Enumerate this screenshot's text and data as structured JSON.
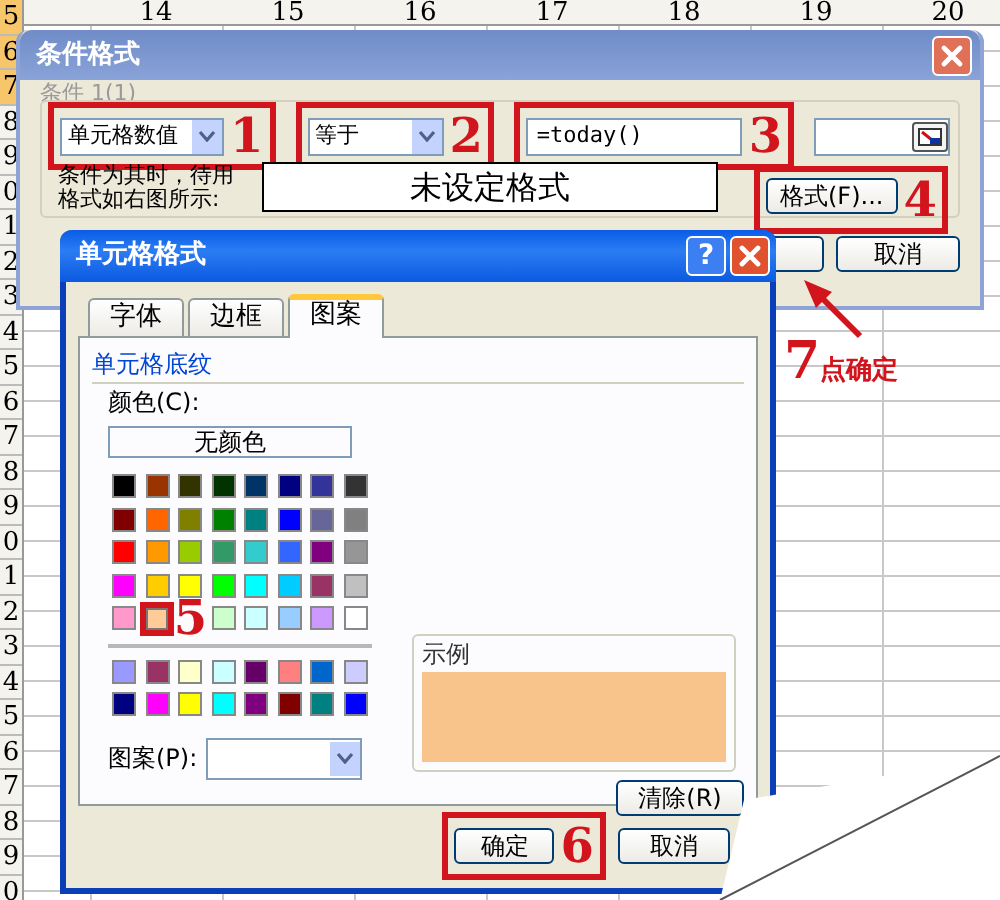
{
  "spreadsheet": {
    "column_headers": [
      "14",
      "15",
      "16",
      "17",
      "18",
      "19",
      "20"
    ],
    "row_headers": [
      {
        "label": "5",
        "selected": true
      },
      {
        "label": "6",
        "selected": true
      },
      {
        "label": "7",
        "selected": true
      },
      {
        "label": "8",
        "selected": false
      },
      {
        "label": "9",
        "selected": false
      },
      {
        "label": "0",
        "selected": false
      },
      {
        "label": "1",
        "selected": false
      },
      {
        "label": "2",
        "selected": false
      },
      {
        "label": "3",
        "selected": false
      },
      {
        "label": "4",
        "selected": false
      },
      {
        "label": "5",
        "selected": false
      },
      {
        "label": "6",
        "selected": false
      },
      {
        "label": "7",
        "selected": false
      },
      {
        "label": "8",
        "selected": false
      },
      {
        "label": "9",
        "selected": false
      },
      {
        "label": "0",
        "selected": false
      },
      {
        "label": "1",
        "selected": false
      },
      {
        "label": "2",
        "selected": false
      },
      {
        "label": "3",
        "selected": false
      },
      {
        "label": "4",
        "selected": false
      },
      {
        "label": "5",
        "selected": false
      },
      {
        "label": "6",
        "selected": false
      },
      {
        "label": "7",
        "selected": false
      },
      {
        "label": "8",
        "selected": false
      },
      {
        "label": "9",
        "selected": false
      },
      {
        "label": "0",
        "selected": false
      }
    ]
  },
  "conditional_format_dialog": {
    "title": "条件格式",
    "condition_label": "条件 1(1)",
    "condition_type": {
      "value": "单元格数值",
      "annotation": "1"
    },
    "operator": {
      "value": "等于",
      "annotation": "2"
    },
    "formula": {
      "value": "=today()",
      "annotation": "3"
    },
    "preview_caption": "条件为其时，待用格式如右图所示:",
    "preview_text": "未设定格式",
    "format_button": {
      "label": "格式(F)...",
      "annotation": "4"
    },
    "cancel_button": "取消"
  },
  "cell_format_dialog": {
    "title": "单元格格式",
    "help_button": "?",
    "tabs": [
      {
        "label": "字体",
        "selected": false
      },
      {
        "label": "边框",
        "selected": false
      },
      {
        "label": "图案",
        "selected": true
      }
    ],
    "shading_group": "单元格底纹",
    "color_label": "颜色(C):",
    "no_color_button": "无颜色",
    "standard_colors": [
      {
        "color": "#000000",
        "selected": false
      },
      {
        "color": "#993300",
        "selected": false
      },
      {
        "color": "#333300",
        "selected": false
      },
      {
        "color": "#003300",
        "selected": false
      },
      {
        "color": "#003366",
        "selected": false
      },
      {
        "color": "#000080",
        "selected": false
      },
      {
        "color": "#333399",
        "selected": false
      },
      {
        "color": "#333333",
        "selected": false
      },
      {
        "color": "#800000",
        "selected": false
      },
      {
        "color": "#ff6600",
        "selected": false
      },
      {
        "color": "#808000",
        "selected": false
      },
      {
        "color": "#008000",
        "selected": false
      },
      {
        "color": "#008080",
        "selected": false
      },
      {
        "color": "#0000ff",
        "selected": false
      },
      {
        "color": "#666699",
        "selected": false
      },
      {
        "color": "#808080",
        "selected": false
      },
      {
        "color": "#ff0000",
        "selected": false
      },
      {
        "color": "#ff9900",
        "selected": false
      },
      {
        "color": "#99cc00",
        "selected": false
      },
      {
        "color": "#339966",
        "selected": false
      },
      {
        "color": "#33cccc",
        "selected": false
      },
      {
        "color": "#3366ff",
        "selected": false
      },
      {
        "color": "#800080",
        "selected": false
      },
      {
        "color": "#969696",
        "selected": false
      },
      {
        "color": "#ff00ff",
        "selected": false
      },
      {
        "color": "#ffcc00",
        "selected": false
      },
      {
        "color": "#ffff00",
        "selected": false
      },
      {
        "color": "#00ff00",
        "selected": false
      },
      {
        "color": "#00ffff",
        "selected": false
      },
      {
        "color": "#00ccff",
        "selected": false
      },
      {
        "color": "#993366",
        "selected": false
      },
      {
        "color": "#c0c0c0",
        "selected": false
      },
      {
        "color": "#ff99cc",
        "selected": false
      },
      {
        "color": "#ffcc99",
        "selected": true,
        "annotation": "5"
      },
      {
        "color": "#ccffcc",
        "selected": false
      },
      {
        "color": "#ccffff",
        "selected": false
      },
      {
        "color": "#99ccff",
        "selected": false
      },
      {
        "color": "#cc99ff",
        "selected": false
      },
      {
        "color": "#ffffff",
        "selected": false
      }
    ],
    "chart_colors": [
      {
        "color": "#9999ff",
        "selected": false
      },
      {
        "color": "#993366",
        "selected": false
      },
      {
        "color": "#ffffcc",
        "selected": false
      },
      {
        "color": "#ccffff",
        "selected": false
      },
      {
        "color": "#660066",
        "selected": false
      },
      {
        "color": "#ff8080",
        "selected": false
      },
      {
        "color": "#0066cc",
        "selected": false
      },
      {
        "color": "#ccccff",
        "selected": false
      },
      {
        "color": "#000080",
        "selected": false
      },
      {
        "color": "#ff00ff",
        "selected": false
      },
      {
        "color": "#ffff00",
        "selected": false
      },
      {
        "color": "#00ffff",
        "selected": false
      },
      {
        "color": "#800080",
        "selected": false
      },
      {
        "color": "#800000",
        "selected": false
      },
      {
        "color": "#008080",
        "selected": false
      },
      {
        "color": "#0000ff",
        "selected": false
      }
    ],
    "pattern_label": "图案(P):",
    "sample_label": "示例",
    "sample": {
      "color": "#f9c48b"
    },
    "clear_button": "清除(R)",
    "ok_button": {
      "label": "确定",
      "annotation": "6"
    },
    "cancel_button": "取消"
  },
  "callout": {
    "number": "7",
    "text": "点确定"
  }
}
